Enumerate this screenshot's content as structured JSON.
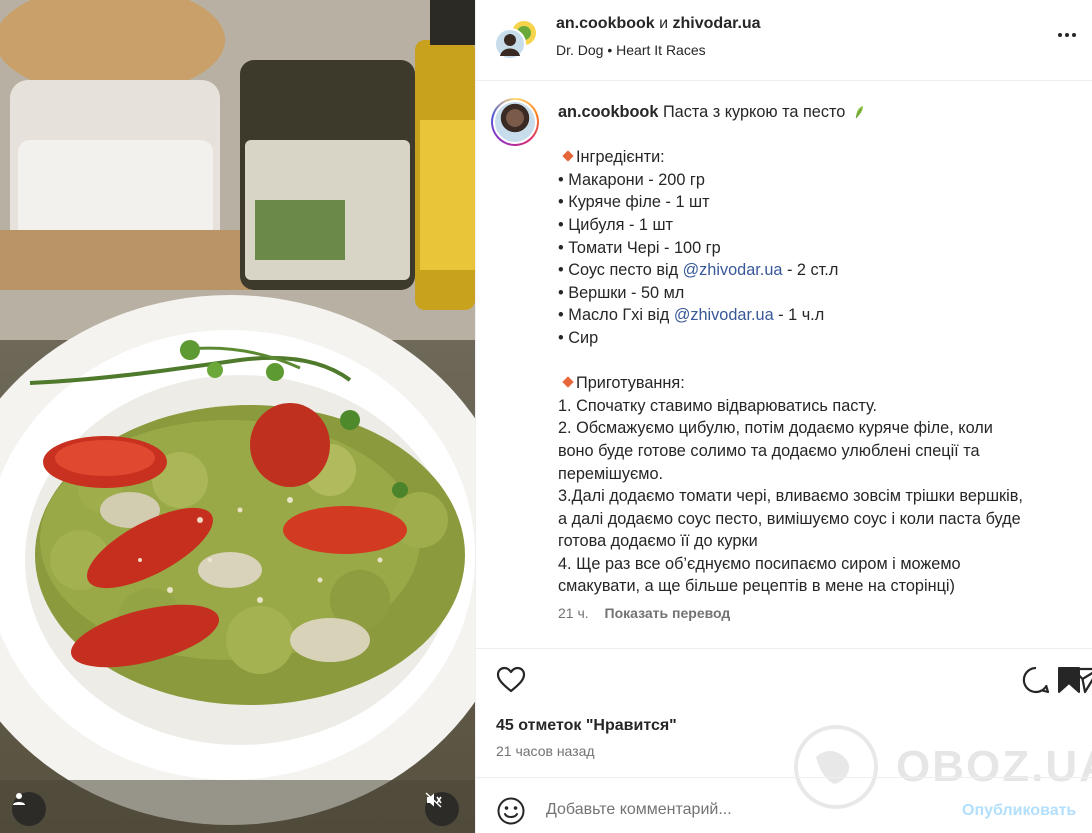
{
  "post": {
    "author": "an.cookbook",
    "conjunction": "и",
    "collaborator": "zhivodar.ua",
    "music_artist": "Dr. Dog",
    "separator": "•",
    "music_title": "Heart It Races"
  },
  "caption": {
    "username": "an.cookbook",
    "title": "Паста з куркою та песто",
    "ingredients_heading": "Інгредієнти:",
    "ingredients": [
      {
        "text": "• Макарони - 200 гр"
      },
      {
        "text": "• Куряче філе - 1 шт"
      },
      {
        "text": "• Цибуля - 1 шт"
      },
      {
        "text": "• Томати Черi - 100 гр"
      },
      {
        "pre": "• Соус песто від ",
        "mention": "@zhivodar.ua",
        "post": " - 2 ст.л"
      },
      {
        "text": "• Вершки - 50 мл"
      },
      {
        "pre": "• Масло Гхі від ",
        "mention": "@zhivodar.ua",
        "post": " - 1 ч.л"
      },
      {
        "text": "• Сир"
      }
    ],
    "method_heading": "Приготування:",
    "method_lines": [
      "1. Спочатку ставимо відварюватись пасту.",
      "2. Обсмажуємо цибулю, потім додаємо куряче філе, коли",
      "воно буде готове солимо та додаємо улюблені спеції та",
      "перемішуємо.",
      "3.Далі додаємо томати чері, вливаємо зовсім трішки вершків,",
      "а далі додаємо соус песто, вимішуємо соус і коли паста буде",
      "готова додаємо її до курки",
      "4. Ще раз все об’єднуємо посипаємо сиром і можемо",
      "смакувати, а ще більше рецептів в мене на сторінці)"
    ],
    "time": "21 ч.",
    "translate_label": "Показать перевод"
  },
  "actions": {
    "like_icon": "heart-outline",
    "comment_icon": "speech-bubble",
    "share_icon": "paper-plane",
    "save_icon": "bookmark-filled"
  },
  "likes_text": "45 отметок \"Нравится\"",
  "posted_ago": "21 часов назад",
  "comment": {
    "placeholder": "Добавьте комментарий...",
    "publish_label": "Опубликовать"
  },
  "watermark": "OBOZ.UA",
  "colors": {
    "publish_disabled": "#b2dffc",
    "mention": "#385898",
    "muted_text": "#737373"
  }
}
